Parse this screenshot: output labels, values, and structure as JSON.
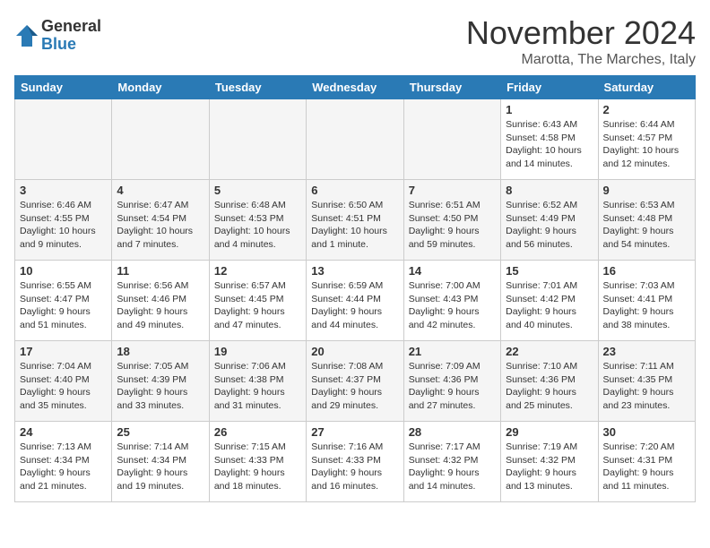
{
  "header": {
    "logo_general": "General",
    "logo_blue": "Blue",
    "month": "November 2024",
    "location": "Marotta, The Marches, Italy"
  },
  "days_of_week": [
    "Sunday",
    "Monday",
    "Tuesday",
    "Wednesday",
    "Thursday",
    "Friday",
    "Saturday"
  ],
  "weeks": [
    [
      {
        "day": "",
        "info": "",
        "empty": true
      },
      {
        "day": "",
        "info": "",
        "empty": true
      },
      {
        "day": "",
        "info": "",
        "empty": true
      },
      {
        "day": "",
        "info": "",
        "empty": true
      },
      {
        "day": "",
        "info": "",
        "empty": true
      },
      {
        "day": "1",
        "info": "Sunrise: 6:43 AM\nSunset: 4:58 PM\nDaylight: 10 hours\nand 14 minutes.",
        "empty": false
      },
      {
        "day": "2",
        "info": "Sunrise: 6:44 AM\nSunset: 4:57 PM\nDaylight: 10 hours\nand 12 minutes.",
        "empty": false
      }
    ],
    [
      {
        "day": "3",
        "info": "Sunrise: 6:46 AM\nSunset: 4:55 PM\nDaylight: 10 hours\nand 9 minutes.",
        "empty": false
      },
      {
        "day": "4",
        "info": "Sunrise: 6:47 AM\nSunset: 4:54 PM\nDaylight: 10 hours\nand 7 minutes.",
        "empty": false
      },
      {
        "day": "5",
        "info": "Sunrise: 6:48 AM\nSunset: 4:53 PM\nDaylight: 10 hours\nand 4 minutes.",
        "empty": false
      },
      {
        "day": "6",
        "info": "Sunrise: 6:50 AM\nSunset: 4:51 PM\nDaylight: 10 hours\nand 1 minute.",
        "empty": false
      },
      {
        "day": "7",
        "info": "Sunrise: 6:51 AM\nSunset: 4:50 PM\nDaylight: 9 hours\nand 59 minutes.",
        "empty": false
      },
      {
        "day": "8",
        "info": "Sunrise: 6:52 AM\nSunset: 4:49 PM\nDaylight: 9 hours\nand 56 minutes.",
        "empty": false
      },
      {
        "day": "9",
        "info": "Sunrise: 6:53 AM\nSunset: 4:48 PM\nDaylight: 9 hours\nand 54 minutes.",
        "empty": false
      }
    ],
    [
      {
        "day": "10",
        "info": "Sunrise: 6:55 AM\nSunset: 4:47 PM\nDaylight: 9 hours\nand 51 minutes.",
        "empty": false
      },
      {
        "day": "11",
        "info": "Sunrise: 6:56 AM\nSunset: 4:46 PM\nDaylight: 9 hours\nand 49 minutes.",
        "empty": false
      },
      {
        "day": "12",
        "info": "Sunrise: 6:57 AM\nSunset: 4:45 PM\nDaylight: 9 hours\nand 47 minutes.",
        "empty": false
      },
      {
        "day": "13",
        "info": "Sunrise: 6:59 AM\nSunset: 4:44 PM\nDaylight: 9 hours\nand 44 minutes.",
        "empty": false
      },
      {
        "day": "14",
        "info": "Sunrise: 7:00 AM\nSunset: 4:43 PM\nDaylight: 9 hours\nand 42 minutes.",
        "empty": false
      },
      {
        "day": "15",
        "info": "Sunrise: 7:01 AM\nSunset: 4:42 PM\nDaylight: 9 hours\nand 40 minutes.",
        "empty": false
      },
      {
        "day": "16",
        "info": "Sunrise: 7:03 AM\nSunset: 4:41 PM\nDaylight: 9 hours\nand 38 minutes.",
        "empty": false
      }
    ],
    [
      {
        "day": "17",
        "info": "Sunrise: 7:04 AM\nSunset: 4:40 PM\nDaylight: 9 hours\nand 35 minutes.",
        "empty": false
      },
      {
        "day": "18",
        "info": "Sunrise: 7:05 AM\nSunset: 4:39 PM\nDaylight: 9 hours\nand 33 minutes.",
        "empty": false
      },
      {
        "day": "19",
        "info": "Sunrise: 7:06 AM\nSunset: 4:38 PM\nDaylight: 9 hours\nand 31 minutes.",
        "empty": false
      },
      {
        "day": "20",
        "info": "Sunrise: 7:08 AM\nSunset: 4:37 PM\nDaylight: 9 hours\nand 29 minutes.",
        "empty": false
      },
      {
        "day": "21",
        "info": "Sunrise: 7:09 AM\nSunset: 4:36 PM\nDaylight: 9 hours\nand 27 minutes.",
        "empty": false
      },
      {
        "day": "22",
        "info": "Sunrise: 7:10 AM\nSunset: 4:36 PM\nDaylight: 9 hours\nand 25 minutes.",
        "empty": false
      },
      {
        "day": "23",
        "info": "Sunrise: 7:11 AM\nSunset: 4:35 PM\nDaylight: 9 hours\nand 23 minutes.",
        "empty": false
      }
    ],
    [
      {
        "day": "24",
        "info": "Sunrise: 7:13 AM\nSunset: 4:34 PM\nDaylight: 9 hours\nand 21 minutes.",
        "empty": false
      },
      {
        "day": "25",
        "info": "Sunrise: 7:14 AM\nSunset: 4:34 PM\nDaylight: 9 hours\nand 19 minutes.",
        "empty": false
      },
      {
        "day": "26",
        "info": "Sunrise: 7:15 AM\nSunset: 4:33 PM\nDaylight: 9 hours\nand 18 minutes.",
        "empty": false
      },
      {
        "day": "27",
        "info": "Sunrise: 7:16 AM\nSunset: 4:33 PM\nDaylight: 9 hours\nand 16 minutes.",
        "empty": false
      },
      {
        "day": "28",
        "info": "Sunrise: 7:17 AM\nSunset: 4:32 PM\nDaylight: 9 hours\nand 14 minutes.",
        "empty": false
      },
      {
        "day": "29",
        "info": "Sunrise: 7:19 AM\nSunset: 4:32 PM\nDaylight: 9 hours\nand 13 minutes.",
        "empty": false
      },
      {
        "day": "30",
        "info": "Sunrise: 7:20 AM\nSunset: 4:31 PM\nDaylight: 9 hours\nand 11 minutes.",
        "empty": false
      }
    ]
  ]
}
